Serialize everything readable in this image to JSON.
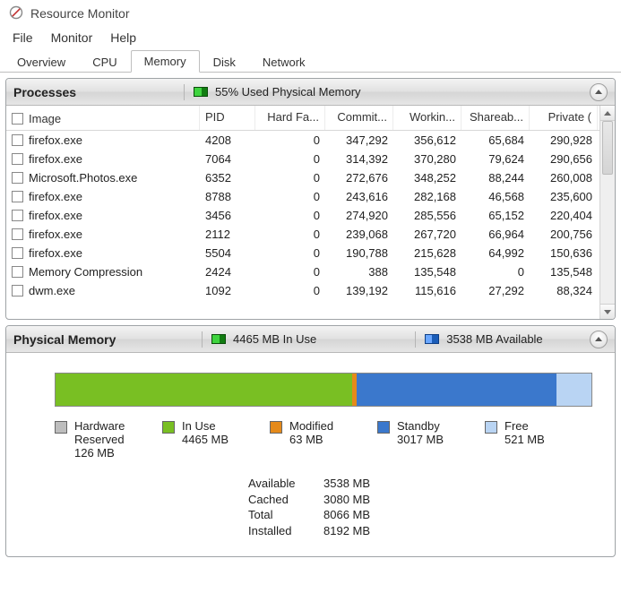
{
  "window": {
    "title": "Resource Monitor"
  },
  "menu": {
    "file": "File",
    "monitor": "Monitor",
    "help": "Help"
  },
  "tabs": {
    "overview": "Overview",
    "cpu": "CPU",
    "memory": "Memory",
    "disk": "Disk",
    "network": "Network",
    "active": "memory"
  },
  "processes_panel": {
    "title": "Processes",
    "status": "55% Used Physical Memory",
    "columns": {
      "image": "Image",
      "pid": "PID",
      "hard_faults": "Hard Fa...",
      "commit": "Commit...",
      "working": "Workin...",
      "shareable": "Shareab...",
      "private": "Private ("
    },
    "rows": [
      {
        "image": "firefox.exe",
        "pid": "4208",
        "hard": "0",
        "commit": "347,292",
        "working": "356,612",
        "share": "65,684",
        "priv": "290,928"
      },
      {
        "image": "firefox.exe",
        "pid": "7064",
        "hard": "0",
        "commit": "314,392",
        "working": "370,280",
        "share": "79,624",
        "priv": "290,656"
      },
      {
        "image": "Microsoft.Photos.exe",
        "pid": "6352",
        "hard": "0",
        "commit": "272,676",
        "working": "348,252",
        "share": "88,244",
        "priv": "260,008"
      },
      {
        "image": "firefox.exe",
        "pid": "8788",
        "hard": "0",
        "commit": "243,616",
        "working": "282,168",
        "share": "46,568",
        "priv": "235,600"
      },
      {
        "image": "firefox.exe",
        "pid": "3456",
        "hard": "0",
        "commit": "274,920",
        "working": "285,556",
        "share": "65,152",
        "priv": "220,404"
      },
      {
        "image": "firefox.exe",
        "pid": "2112",
        "hard": "0",
        "commit": "239,068",
        "working": "267,720",
        "share": "66,964",
        "priv": "200,756"
      },
      {
        "image": "firefox.exe",
        "pid": "5504",
        "hard": "0",
        "commit": "190,788",
        "working": "215,628",
        "share": "64,992",
        "priv": "150,636"
      },
      {
        "image": "Memory Compression",
        "pid": "2424",
        "hard": "0",
        "commit": "388",
        "working": "135,548",
        "share": "0",
        "priv": "135,548"
      },
      {
        "image": "dwm.exe",
        "pid": "1092",
        "hard": "0",
        "commit": "139,192",
        "working": "115,616",
        "share": "27,292",
        "priv": "88,324"
      }
    ]
  },
  "physical_memory_panel": {
    "title": "Physical Memory",
    "in_use_text": "4465 MB In Use",
    "available_text": "3538 MB Available",
    "legend": {
      "hw": {
        "label": "Hardware Reserved",
        "value": "126 MB"
      },
      "inuse": {
        "label": "In Use",
        "value": "4465 MB"
      },
      "modified": {
        "label": "Modified",
        "value": "63 MB"
      },
      "standby": {
        "label": "Standby",
        "value": "3017 MB"
      },
      "free": {
        "label": "Free",
        "value": "521 MB"
      }
    },
    "summary": {
      "available": {
        "k": "Available",
        "v": "3538 MB"
      },
      "cached": {
        "k": "Cached",
        "v": "3080 MB"
      },
      "total": {
        "k": "Total",
        "v": "8066 MB"
      },
      "installed": {
        "k": "Installed",
        "v": "8192 MB"
      }
    }
  },
  "chart_data": {
    "type": "bar",
    "title": "Physical Memory",
    "categories": [
      "Hardware Reserved",
      "In Use",
      "Modified",
      "Standby",
      "Free"
    ],
    "values_mb": [
      126,
      4465,
      63,
      3017,
      521
    ],
    "installed_mb": 8192,
    "total_mb": 8066,
    "available_mb": 3538,
    "cached_mb": 3080,
    "percent_used": 55
  }
}
